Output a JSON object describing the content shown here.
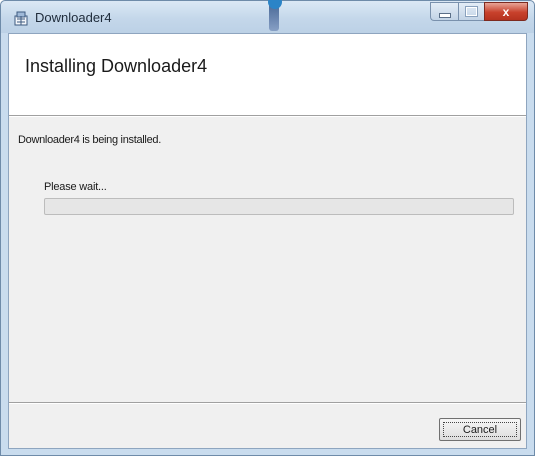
{
  "window": {
    "title": "Downloader4",
    "icon": "installer-app-icon",
    "controls": {
      "minimize": "minimize-icon",
      "maximize": "maximize-icon",
      "close": "close-icon",
      "close_glyph": "x"
    }
  },
  "header": {
    "title": "Installing Downloader4"
  },
  "body": {
    "status": "Downloader4 is being installed.",
    "wait_label": "Please wait...",
    "progress_percent": 0
  },
  "footer": {
    "cancel_label": "Cancel"
  },
  "colors": {
    "close_button": "#c8412c",
    "progress_fill": "#37b82a",
    "title_accent": "#2b84c7"
  }
}
